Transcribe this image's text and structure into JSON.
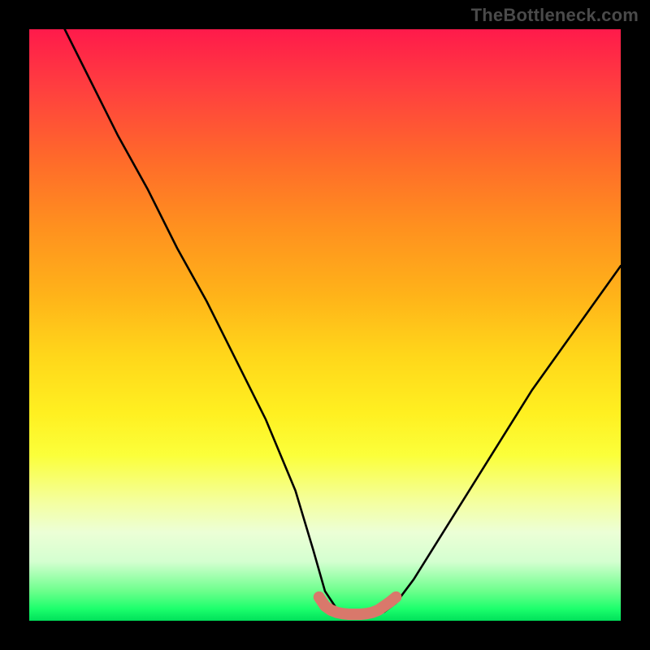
{
  "watermark": "TheBottleneck.com",
  "chart_data": {
    "type": "line",
    "title": "",
    "xlabel": "",
    "ylabel": "",
    "xlim": [
      0,
      100
    ],
    "ylim": [
      0,
      100
    ],
    "series": [
      {
        "name": "bottleneck-curve",
        "x": [
          6,
          10,
          15,
          20,
          25,
          30,
          35,
          40,
          45,
          48,
          50,
          52,
          54,
          56,
          58,
          60,
          62,
          65,
          70,
          75,
          80,
          85,
          90,
          95,
          100
        ],
        "values": [
          100,
          92,
          82,
          73,
          63,
          54,
          44,
          34,
          22,
          12,
          5,
          2,
          1,
          1,
          1,
          1.5,
          3,
          7,
          15,
          23,
          31,
          39,
          46,
          53,
          60
        ]
      },
      {
        "name": "sweet-spot-band",
        "x": [
          49,
          50,
          51,
          52,
          53,
          54,
          55,
          56,
          57,
          58,
          59,
          60,
          61,
          62
        ],
        "values": [
          4,
          2.5,
          1.8,
          1.4,
          1.2,
          1.1,
          1.1,
          1.1,
          1.2,
          1.4,
          1.8,
          2.5,
          3.2,
          4
        ]
      }
    ]
  },
  "colors": {
    "curve": "#000000",
    "sweet_spot": "#d9786b",
    "background_frame": "#000000"
  }
}
